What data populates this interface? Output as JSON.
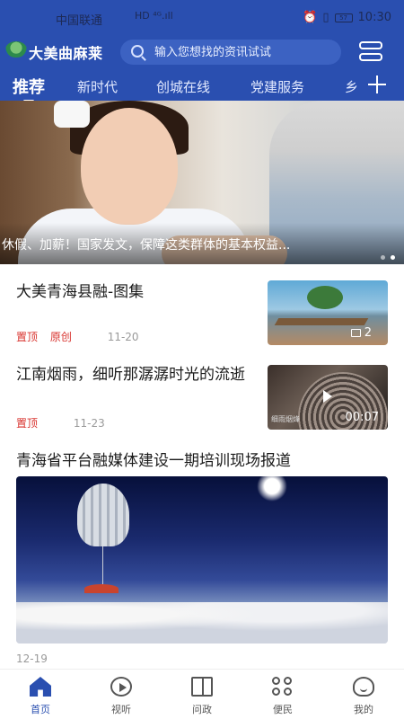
{
  "status_bar": {
    "carrier": "中国联通",
    "signal": "HD ⁴ᴳ.ıll",
    "battery": "57",
    "time": "10:30"
  },
  "header": {
    "brand": "大美曲麻莱",
    "search_placeholder": "输入您想找的资讯试试"
  },
  "tabs": [
    {
      "label": "推荐",
      "active": true
    },
    {
      "label": "新时代"
    },
    {
      "label": "创城在线"
    },
    {
      "label": "党建服务"
    },
    {
      "label": "乡"
    }
  ],
  "banner": {
    "caption": "休假、加薪！国家发文，保障这类群体的基本权益..."
  },
  "news": [
    {
      "title": "大美青海县融-图集",
      "tags": [
        "置顶",
        "原创"
      ],
      "date": "11-20",
      "photo_count": "2"
    },
    {
      "title": "江南烟雨，细听那潺潺时光的流逝",
      "tags": [
        "置顶"
      ],
      "date": "11-23",
      "duration": "00:07",
      "watermark": "细雨烟烽"
    },
    {
      "title": "青海省平台融媒体建设一期培训现场报道",
      "date": "12-19"
    }
  ],
  "bottom_nav": [
    {
      "label": "首页",
      "icon": "home-icon",
      "active": true
    },
    {
      "label": "视听",
      "icon": "play-icon"
    },
    {
      "label": "问政",
      "icon": "book-icon"
    },
    {
      "label": "便民",
      "icon": "grid-icon"
    },
    {
      "label": "我的",
      "icon": "person-icon"
    }
  ],
  "colors": {
    "brand_blue": "#2a4fb0",
    "tag_red": "#d8332e"
  }
}
